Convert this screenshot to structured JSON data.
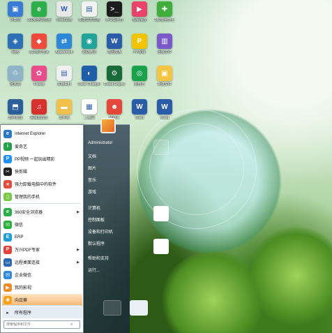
{
  "desktop": {
    "icons": [
      {
        "label": "计算机",
        "color": "#3a7bd5",
        "glyph": "▣",
        "icon": "computer-icon"
      },
      {
        "label": "360安全浏览器",
        "color": "#2cae4a",
        "glyph": "e",
        "icon": "browser-icon"
      },
      {
        "label": "Word文档",
        "color": "#e8e8e8",
        "glyph": "W",
        "icon": "document-icon"
      },
      {
        "label": "新建文本文档",
        "color": "#f2f2f2",
        "glyph": "▤",
        "icon": "text-file-icon"
      },
      {
        "label": "命令提示符",
        "color": "#1c1c1c",
        "glyph": ">_",
        "icon": "terminal-icon"
      },
      {
        "label": "视频播放",
        "color": "#e9436b",
        "glyph": "▶",
        "icon": "video-icon"
      },
      {
        "label": "360安全卫士",
        "color": "#3fae3a",
        "glyph": "✚",
        "icon": "security-icon"
      },
      {
        "label": "网络",
        "color": "#2f6fb5",
        "glyph": "◈",
        "icon": "network-icon"
      },
      {
        "label": "360软件管家",
        "color": "#f04a3c",
        "glyph": "◆",
        "icon": "app-store-icon"
      },
      {
        "label": "Apowersoft",
        "color": "#2e88d8",
        "glyph": "⇄",
        "icon": "transfer-icon"
      },
      {
        "label": "驱动精灵",
        "color": "#21a39b",
        "glyph": "◉",
        "icon": "driver-icon"
      },
      {
        "label": "简历模板",
        "color": "#2a5caa",
        "glyph": "W",
        "icon": "word-icon"
      },
      {
        "label": "PP视频",
        "color": "#f5c400",
        "glyph": "P",
        "icon": "pp-video-icon"
      },
      {
        "label": "压缩文件",
        "color": "#7a5ac8",
        "glyph": "▥",
        "icon": "archive-icon"
      },
      {
        "label": "回收站",
        "color": "#8fb3c8",
        "glyph": "♲",
        "icon": "recycle-bin-icon"
      },
      {
        "label": "Picasa",
        "color": "#e94c8b",
        "glyph": "✿",
        "icon": "photo-icon"
      },
      {
        "label": "文档资料",
        "color": "#efefef",
        "glyph": "▤",
        "icon": "file-icon"
      },
      {
        "label": "Voice Changer",
        "color": "#1f5ea8",
        "glyph": "◐",
        "icon": "voice-icon"
      },
      {
        "label": "Cheat Engine",
        "color": "#1a6b3a",
        "glyph": "⚙",
        "icon": "engine-icon"
      },
      {
        "label": "爱奇艺",
        "color": "#18a24a",
        "glyph": "◎",
        "icon": "player-icon"
      },
      {
        "label": "新建文件",
        "color": "#f4c542",
        "glyph": "▣",
        "icon": "folder-icon"
      },
      {
        "label": "软件管理",
        "color": "#2b5f9b",
        "glyph": "⬒",
        "icon": "software-icon"
      },
      {
        "label": "网易云音乐",
        "color": "#d8302c",
        "glyph": "♫",
        "icon": "music-icon"
      },
      {
        "label": "文件夹",
        "color": "#f0c04a",
        "glyph": "▬",
        "icon": "folder-icon-2"
      },
      {
        "label": "二维码",
        "color": "#ffffff",
        "glyph": "▦",
        "icon": "qrcode-icon"
      },
      {
        "label": "机器人",
        "color": "#e6473b",
        "glyph": "☻",
        "icon": "robot-icon"
      },
      {
        "label": "Word",
        "color": "#2a5caa",
        "glyph": "W",
        "icon": "word-icon-2"
      },
      {
        "label": "Word",
        "color": "#2a5caa",
        "glyph": "W",
        "icon": "word-icon-3"
      }
    ]
  },
  "start_menu": {
    "programs": [
      {
        "label": "Internet Explorer",
        "color": "#2a78c8",
        "glyph": "e",
        "icon": "ie-icon",
        "submenu": false
      },
      {
        "label": "爱奇艺",
        "color": "#22a34a",
        "glyph": "i",
        "icon": "iqiyi-icon",
        "submenu": false
      },
      {
        "label": "PP视频 一起玩出精彩",
        "color": "#1e90ff",
        "glyph": "P",
        "icon": "ppvideo-icon",
        "submenu": false
      },
      {
        "label": "快剪辑",
        "color": "#222222",
        "glyph": "✂",
        "icon": "scissors-icon",
        "submenu": false
      },
      {
        "label": "强力卸载电脑中的软件",
        "color": "#e84a3b",
        "glyph": "⨯",
        "icon": "uninstall-icon",
        "submenu": false
      },
      {
        "label": "管理我的手机",
        "color": "#7ac943",
        "glyph": "▯",
        "icon": "phone-icon",
        "submenu": false
      },
      {
        "label": "360安全浏览器",
        "color": "#2cae4a",
        "glyph": "e",
        "icon": "browser-icon",
        "submenu": true
      },
      {
        "label": "微信",
        "color": "#25b33a",
        "glyph": "✉",
        "icon": "wechat-icon",
        "submenu": false
      },
      {
        "label": "ERP",
        "color": "#1a9fd9",
        "glyph": "E",
        "icon": "erp-icon",
        "submenu": false
      },
      {
        "label": "万兴PDF专家",
        "color": "#e8413a",
        "glyph": "P",
        "icon": "pdf-icon",
        "submenu": true
      },
      {
        "label": "远程桌面连接",
        "color": "#2c68b2",
        "glyph": "▭",
        "icon": "remote-desktop-icon",
        "submenu": true
      },
      {
        "label": "企业微信",
        "color": "#2f8ae0",
        "glyph": "✉",
        "icon": "wecom-icon",
        "submenu": false
      },
      {
        "label": "我的影视",
        "color": "#f08a24",
        "glyph": "▶",
        "icon": "movie-icon",
        "submenu": false
      },
      {
        "label": "向日葵",
        "color": "#f4a321",
        "glyph": "✺",
        "icon": "sunflower-icon",
        "submenu": false
      }
    ],
    "all_programs": "所有程序",
    "search_placeholder": "搜索程序和文件",
    "user_name": "Administrator",
    "right_links": [
      "文档",
      "图片",
      "音乐",
      "游戏",
      "计算机",
      "控制面板",
      "设备和打印机",
      "默认程序",
      "帮助和支持",
      "运行..."
    ]
  }
}
